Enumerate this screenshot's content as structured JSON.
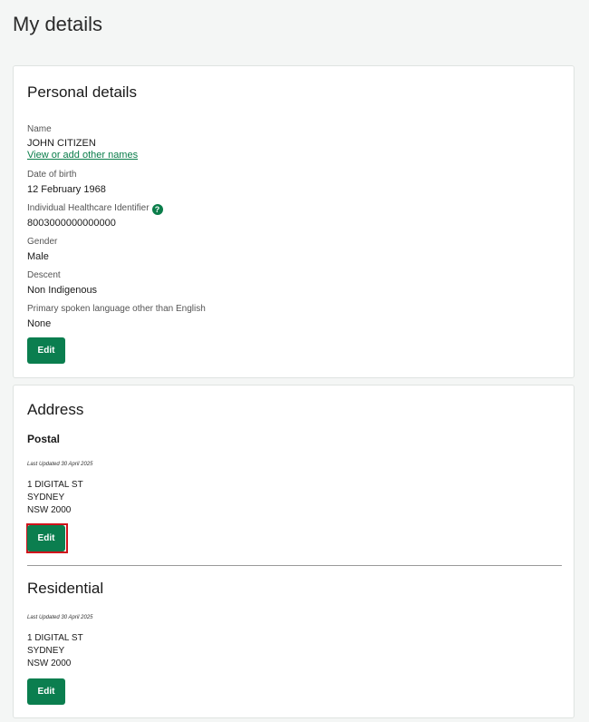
{
  "page": {
    "title": "My details"
  },
  "personal": {
    "heading": "Personal details",
    "name_label": "Name",
    "name_value": "JOHN CITIZEN",
    "other_names_link": "View or add other names",
    "dob_label": "Date of birth",
    "dob_value": "12 February 1968",
    "ihi_label": "Individual Healthcare Identifier",
    "ihi_help_icon": "?",
    "ihi_value": "8003000000000000",
    "gender_label": "Gender",
    "gender_value": "Male",
    "descent_label": "Descent",
    "descent_value": "Non Indigenous",
    "language_label": "Primary spoken language other than English",
    "language_value": "None",
    "edit_label": "Edit"
  },
  "address": {
    "heading": "Address",
    "postal": {
      "heading": "Postal",
      "updated": "Last Updated 30 April 2025",
      "line1": "1 DIGITAL ST",
      "line2": "SYDNEY",
      "line3": "NSW 2000",
      "edit_label": "Edit"
    },
    "residential": {
      "heading": "Residential",
      "updated": "Last Updated 30 April 2025",
      "line1": "1 DIGITAL ST",
      "line2": "SYDNEY",
      "line3": "NSW 2000",
      "edit_label": "Edit"
    }
  },
  "colors": {
    "primary_green": "#0b7e4f",
    "link_green": "#0a7d4a",
    "highlight_red": "#d0121b",
    "page_background": "#f4f6f5"
  },
  "icons": {
    "help": "question-circle-icon"
  }
}
